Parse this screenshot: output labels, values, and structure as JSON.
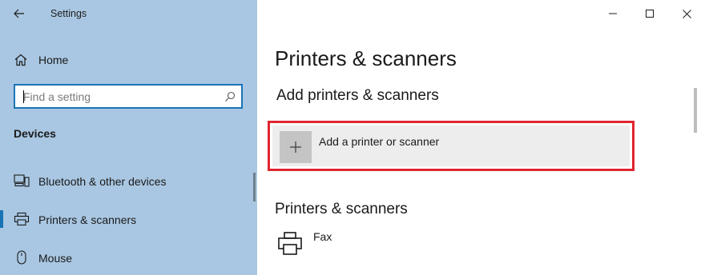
{
  "window": {
    "title": "Settings"
  },
  "sidebar": {
    "home_label": "Home",
    "search": {
      "placeholder": "Find a setting",
      "value": ""
    },
    "section_label": "Devices",
    "items": [
      {
        "label": "Bluetooth & other devices",
        "icon": "bluetooth-devices-icon",
        "active": false
      },
      {
        "label": "Printers & scanners",
        "icon": "printer-icon",
        "active": true
      },
      {
        "label": "Mouse",
        "icon": "mouse-icon",
        "active": false
      }
    ]
  },
  "main": {
    "title": "Printers & scanners",
    "add_section": {
      "heading": "Add printers & scanners",
      "add_button_label": "Add a printer or scanner"
    },
    "list_section": {
      "heading": "Printers & scanners",
      "devices": [
        {
          "name": "Fax",
          "icon": "printer-icon"
        }
      ]
    }
  },
  "colors": {
    "sidebar_bg": "#a9c7e2",
    "accent": "#1a73b6",
    "highlight": "#e0252f",
    "tile_bg": "#ededed"
  }
}
